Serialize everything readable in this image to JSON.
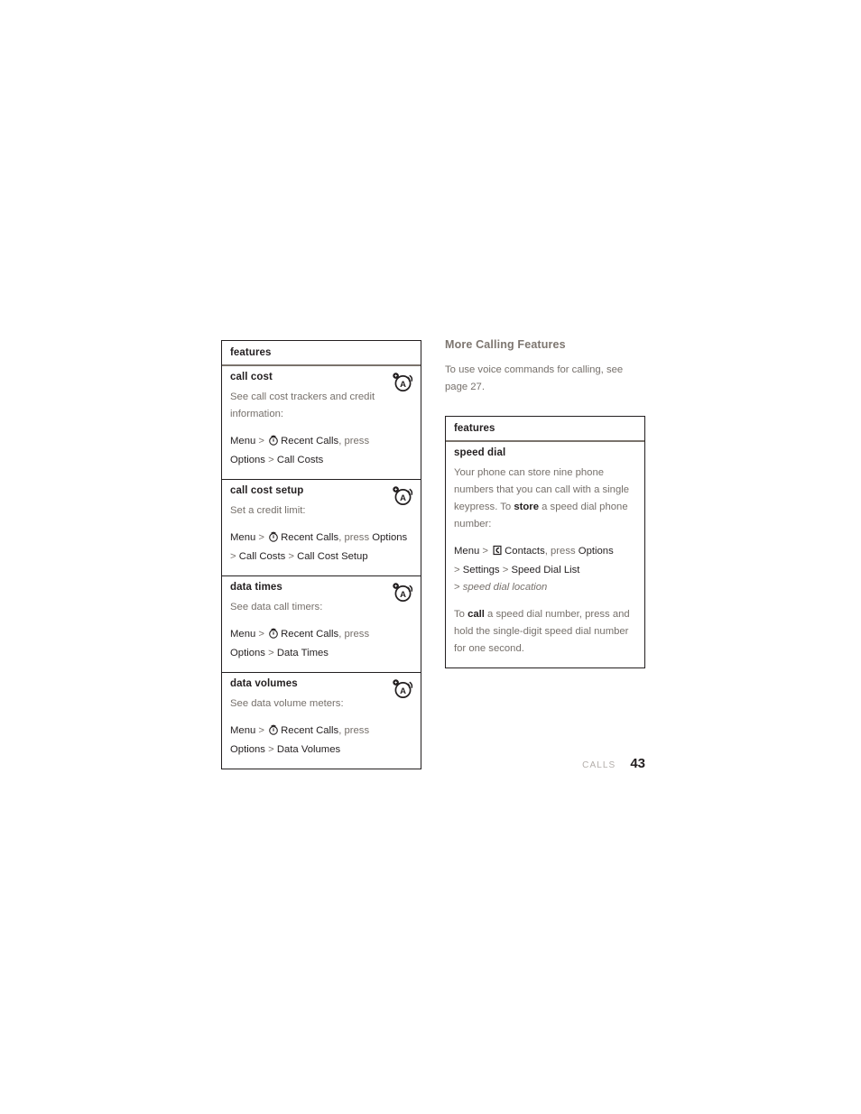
{
  "page": {
    "footer_section": "CALLS",
    "footer_page_number": "43"
  },
  "left_column": {
    "table": {
      "header": "features",
      "rows": [
        {
          "title": "call cost",
          "icon": "voice-command-icon",
          "description": "See call cost trackers and credit information:",
          "path_line1_a": "Menu",
          "path_line1_sep1": " > ",
          "path_icon": "recent-calls-clock-icon",
          "path_line1_b": "Recent Calls",
          "path_line1_c": ", press",
          "path_line2_a": "Options",
          "path_line2_sep": " > ",
          "path_line2_b": "Call Costs"
        },
        {
          "title": "call cost setup",
          "icon": "voice-command-icon",
          "description": "Set a credit limit:",
          "path_line1_a": "Menu",
          "path_line1_sep1": " > ",
          "path_icon": "recent-calls-clock-icon",
          "path_line1_b": "Recent Calls",
          "path_line1_c": ", press ",
          "path_line1_d": "Options",
          "path_line2_sep": "> ",
          "path_line2_a": "Call Costs",
          "path_line2_sep2": " > ",
          "path_line2_b": "Call Cost Setup"
        },
        {
          "title": "data times",
          "icon": "voice-command-icon",
          "description": "See data call timers:",
          "path_line1_a": "Menu",
          "path_line1_sep1": " > ",
          "path_icon": "recent-calls-clock-icon",
          "path_line1_b": "Recent Calls",
          "path_line1_c": ", press",
          "path_line2_a": "Options",
          "path_line2_sep": " > ",
          "path_line2_b": "Data Times"
        },
        {
          "title": "data volumes",
          "icon": "voice-command-icon",
          "description": "See data volume meters:",
          "path_line1_a": "Menu",
          "path_line1_sep1": " > ",
          "path_icon": "recent-calls-clock-icon",
          "path_line1_b": "Recent Calls",
          "path_line1_c": ", press",
          "path_line2_a": "Options",
          "path_line2_sep": " > ",
          "path_line2_b": "Data Volumes"
        }
      ]
    }
  },
  "right_column": {
    "heading": "More Calling Features",
    "lead": "To use voice commands for calling, see page 27.",
    "table": {
      "header": "features",
      "row": {
        "title": "speed dial",
        "desc_a": "Your phone can store nine phone numbers that you can call with a single keypress. To ",
        "desc_bold": "store",
        "desc_b": " a speed dial phone number:",
        "path_line1_a": "Menu",
        "path_line1_sep1": " > ",
        "path_icon": "contacts-icon",
        "path_line1_b": "Contacts",
        "path_line1_c": ", press ",
        "path_line1_d": "Options",
        "path_line2_sep": "> ",
        "path_line2_a": "Settings",
        "path_line2_sep2": " > ",
        "path_line2_b": "Speed Dial List",
        "path_line3_sep": "> ",
        "path_line3_italic": "speed dial location",
        "note_a": "To ",
        "note_bold": "call",
        "note_b": " a speed dial number, press and hold the single-digit speed dial number for one second."
      }
    }
  }
}
